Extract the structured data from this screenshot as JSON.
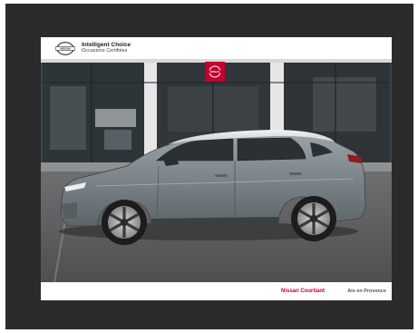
{
  "header": {
    "logo_text": "NISSAN",
    "program_title": "Intelligent Choice",
    "program_subtitle": "Occasions Certifiées"
  },
  "storefront_sign": "NISSAN",
  "footer": {
    "dealer_name": "Nissan Courtiant",
    "location": "Aix en Provence"
  },
  "colors": {
    "car_body": "#7b8489",
    "brand_red": "#c3002f",
    "frame": "#2b2b2b"
  }
}
